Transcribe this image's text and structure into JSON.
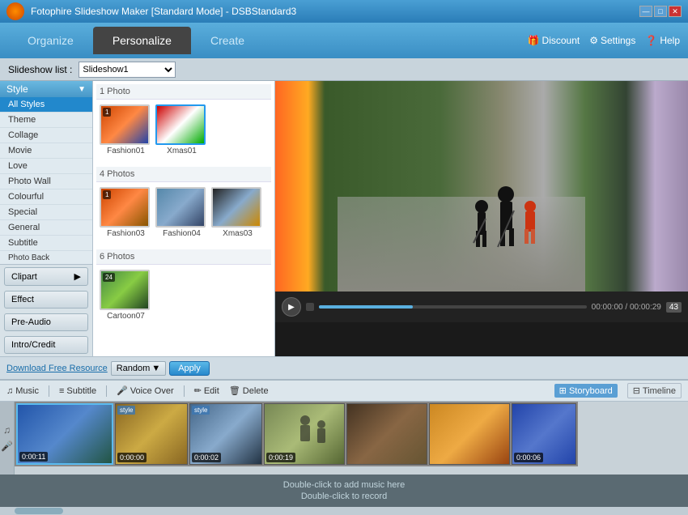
{
  "app": {
    "title": "Fotophire Slideshow Maker [Standard Mode] - DSBStandard3",
    "logo_text": "F"
  },
  "titlebar": {
    "minimize": "—",
    "maximize": "□",
    "close": "✕"
  },
  "nav": {
    "tabs": [
      {
        "label": "Organize",
        "active": false
      },
      {
        "label": "Personalize",
        "active": true
      },
      {
        "label": "Create",
        "active": false
      }
    ],
    "discount": "Discount",
    "settings": "Settings",
    "help": "Help"
  },
  "slideshow_bar": {
    "label": "Slideshow list :",
    "value": "Slideshow1"
  },
  "left_panel": {
    "style_header": "Style",
    "categories": [
      {
        "label": "All Styles",
        "active": true
      },
      {
        "label": "Theme"
      },
      {
        "label": "Collage"
      },
      {
        "label": "Movie"
      },
      {
        "label": "Love"
      },
      {
        "label": "Photo Wall"
      },
      {
        "label": "Colourful"
      },
      {
        "label": "Special"
      },
      {
        "label": "General"
      },
      {
        "label": "Subtitle"
      },
      {
        "label": "Photo Back"
      }
    ],
    "clipart_btn": "Clipart",
    "effect_btn": "Effect",
    "pre_audio_btn": "Pre-Audio",
    "intro_credit_btn": "Intro/Credit"
  },
  "styles_panel": {
    "section1": {
      "label": "1 Photo",
      "items": [
        {
          "name": "Fashion01",
          "selected": false
        },
        {
          "name": "Xmas01",
          "selected": true
        }
      ]
    },
    "section2": {
      "label": "4 Photos",
      "items": [
        {
          "name": "Fashion03",
          "selected": false
        },
        {
          "name": "Fashion04",
          "selected": false
        },
        {
          "name": "Xmas03",
          "selected": false
        }
      ]
    },
    "section3": {
      "label": "6 Photos",
      "items": [
        {
          "name": "Cartoon07",
          "selected": false
        }
      ]
    }
  },
  "action_row": {
    "download_link": "Download Free Resource",
    "random_btn": "Random",
    "apply_btn": "Apply"
  },
  "preview": {
    "time_current": "00:00:00",
    "time_total": "00:00:29",
    "frame_count": "43"
  },
  "bottom_toolbar": {
    "music_btn": "Music",
    "subtitle_btn": "Subtitle",
    "voiceover_btn": "Voice Over",
    "edit_btn": "Edit",
    "delete_btn": "Delete",
    "storyboard_btn": "Storyboard",
    "timeline_btn": "Timeline"
  },
  "storyboard": {
    "items": [
      {
        "time": "0:00:11",
        "has_label": false,
        "bg": "sb1"
      },
      {
        "time": "0:00:00",
        "label": "style",
        "bg": "sb2"
      },
      {
        "time": "0:00:02",
        "label": "style",
        "bg": "sb3"
      },
      {
        "time": "0:00:19",
        "has_label": false,
        "bg": "sb4"
      },
      {
        "time": "",
        "has_label": false,
        "bg": "sb5"
      },
      {
        "time": "",
        "has_label": false,
        "bg": "sb6"
      },
      {
        "time": "0:00:06",
        "has_label": false,
        "bg": "sb7"
      }
    ]
  },
  "media_area": {
    "music_hint": "Double-click to add music here",
    "record_hint": "Double-click to record"
  }
}
